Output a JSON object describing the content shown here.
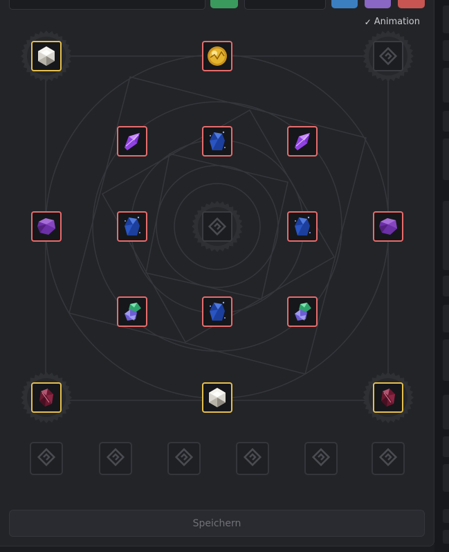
{
  "header": {
    "animation_label": "Animation",
    "colors": {
      "green": "#3a9a5e",
      "blue": "#3b7fc1",
      "purple": "#8a66c5",
      "red": "#c85552"
    }
  },
  "board": {
    "slots": [
      {
        "row": 0,
        "col": 0,
        "gem": "white-crystal",
        "frame": "gold"
      },
      {
        "row": 0,
        "col": 2,
        "gem": "gold-orb",
        "frame": "red"
      },
      {
        "row": 0,
        "col": 4,
        "gem": "empty",
        "frame": "empty"
      },
      {
        "row": 1,
        "col": 1,
        "gem": "amethyst-shard",
        "frame": "red"
      },
      {
        "row": 1,
        "col": 2,
        "gem": "sapphire-crystal",
        "frame": "red"
      },
      {
        "row": 1,
        "col": 3,
        "gem": "amethyst-shard",
        "frame": "red"
      },
      {
        "row": 2,
        "col": 0,
        "gem": "purple-gem",
        "frame": "red"
      },
      {
        "row": 2,
        "col": 1,
        "gem": "sapphire-crystal",
        "frame": "red"
      },
      {
        "row": 2,
        "col": 2,
        "gem": "empty",
        "frame": "empty"
      },
      {
        "row": 2,
        "col": 3,
        "gem": "sapphire-crystal",
        "frame": "red"
      },
      {
        "row": 2,
        "col": 4,
        "gem": "purple-gem",
        "frame": "red"
      },
      {
        "row": 3,
        "col": 1,
        "gem": "emerald-cluster",
        "frame": "red"
      },
      {
        "row": 3,
        "col": 2,
        "gem": "sapphire-crystal",
        "frame": "red"
      },
      {
        "row": 3,
        "col": 3,
        "gem": "emerald-cluster",
        "frame": "red"
      },
      {
        "row": 4,
        "col": 0,
        "gem": "ruby-crystal",
        "frame": "gold"
      },
      {
        "row": 4,
        "col": 2,
        "gem": "white-crystal",
        "frame": "gold"
      },
      {
        "row": 4,
        "col": 4,
        "gem": "ruby-crystal",
        "frame": "gold"
      }
    ]
  },
  "inventory": {
    "slot_count": 6
  },
  "actions": {
    "save_label": "Speichern"
  }
}
